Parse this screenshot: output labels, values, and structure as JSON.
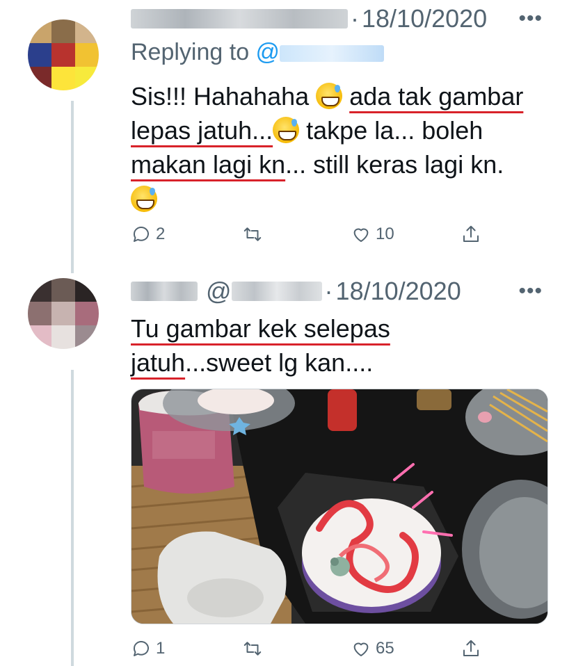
{
  "tweets": [
    {
      "name": "",
      "handle": "",
      "date": "18/10/2020",
      "more": "•••",
      "replying_prefix": "Replying to ",
      "replying_handle": "@",
      "text": {
        "p1": "Sis!!! Hahahaha ",
        "p2": "ada tak gambar",
        "p3": "lepas jatuh...",
        "p4": " takpe la... boleh ",
        "p5": "makan lagi kn",
        "p6": "... still keras lagi kn."
      },
      "emoji": "grinning-face-with-sweat",
      "actions": {
        "replies": "2",
        "retweets": "",
        "likes": "10"
      }
    },
    {
      "name": "",
      "handle_prefix": "@",
      "date": "18/10/2020",
      "more": "•••",
      "text": {
        "p1": "Tu gambar kek selepas",
        "p2": "jatuh",
        "p3": "...sweet lg kan...."
      },
      "image_alt": "photo of a dropped cake with candles on a table",
      "actions": {
        "replies": "1",
        "retweets": "",
        "likes": "65"
      }
    }
  ],
  "colors": {
    "text": "#0f1419",
    "muted": "#536471",
    "link": "#1d9bf0",
    "underline": "#d8222a"
  }
}
